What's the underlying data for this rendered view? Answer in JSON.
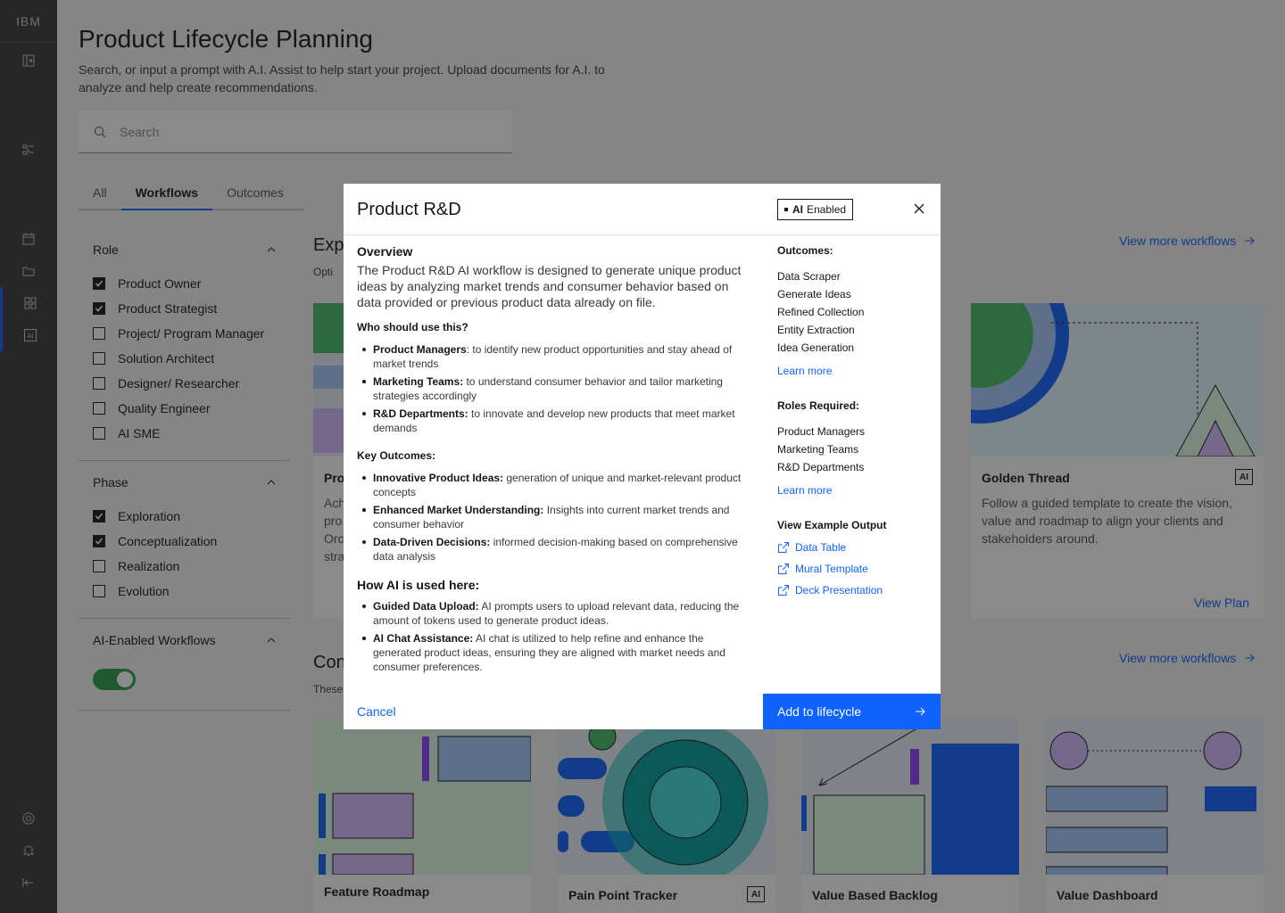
{
  "rail": {
    "logo": "IBM"
  },
  "page": {
    "title": "Product Lifecycle Planning",
    "description": "Search, or input a prompt with A.I. Assist to help start your project. Upload documents for A.I. to analyze and help create recommendations.",
    "search_placeholder": "Search",
    "tabs": [
      "All",
      "Workflows",
      "Outcomes"
    ]
  },
  "filters": {
    "role": {
      "title": "Role",
      "items": [
        {
          "label": "Product Owner",
          "checked": true
        },
        {
          "label": "Product Strategist",
          "checked": true
        },
        {
          "label": "Project/ Program Manager",
          "checked": false
        },
        {
          "label": "Solution Architect",
          "checked": false
        },
        {
          "label": "Designer/ Researcher",
          "checked": false
        },
        {
          "label": "Quality Engineer",
          "checked": false
        },
        {
          "label": "AI SME",
          "checked": false
        }
      ]
    },
    "phase": {
      "title": "Phase",
      "items": [
        {
          "label": "Exploration",
          "checked": true
        },
        {
          "label": "Conceptualization",
          "checked": true
        },
        {
          "label": "Realization",
          "checked": false
        },
        {
          "label": "Evolution",
          "checked": false
        }
      ]
    },
    "ai": {
      "title": "AI-Enabled Workflows",
      "on": true
    }
  },
  "sections": {
    "s1": {
      "title": "Exp",
      "sub": "Opti",
      "link": "View more workflows"
    },
    "s2": {
      "title": "Con",
      "sub": "These",
      "link": "View more workflows"
    }
  },
  "cards": {
    "pro": {
      "title": "Pro",
      "desc": "Ach pro Orc stra"
    },
    "golden": {
      "title": "Golden Thread",
      "ai": "AI",
      "desc": "Follow a guided template to create the vision, value and roadmap to align your clients and stakeholders around.",
      "link": "View Plan"
    },
    "feature": {
      "title": "Feature Roadmap"
    },
    "pain": {
      "title": "Pain Point Tracker",
      "ai": "AI"
    },
    "backlog": {
      "title": "Value Based Backlog"
    },
    "dashboard": {
      "title": "Value Dashboard"
    }
  },
  "modal": {
    "title": "Product R&D",
    "badge_ai": "AI",
    "badge_text": "Enabled",
    "overview_title": "Overview",
    "overview": "The Product R&D AI workflow is designed to generate unique product ideas by analyzing market trends and consumer behavior based on data provided or previous product data already on file.",
    "who_title": "Who should use this?",
    "who": [
      {
        "b": "Product Managers",
        "t": ": to identify new product opportunities and stay ahead of market trends"
      },
      {
        "b": "Marketing Teams:",
        "t": " to understand consumer behavior and tailor marketing strategies accordingly"
      },
      {
        "b": "R&D Departments:",
        "t": " to innovate and develop new products that meet market demands"
      }
    ],
    "key_title": "Key Outcomes:",
    "key": [
      {
        "b": "Innovative Product Ideas:",
        "t": " generation of unique and market-relevant product concepts"
      },
      {
        "b": "Enhanced Market Understanding:",
        "t": " Insights into current market trends and consumer behavior"
      },
      {
        "b": "Data-Driven Decisions:",
        "t": " informed decision-making based on comprehensive data analysis"
      }
    ],
    "how_title": "How AI is used here:",
    "how": [
      {
        "b": "Guided Data Upload:",
        "t": " AI prompts users to upload relevant data, reducing the amount of tokens used to generate product ideas."
      },
      {
        "b": "AI Chat Assistance:",
        "t": " AI chat is utilized to help refine and enhance the generated product ideas, ensuring they are aligned with market needs and consumer preferences."
      }
    ],
    "outcomes_title": "Outcomes:",
    "outcomes": [
      "Data Scraper",
      "Generate Ideas",
      "Refined Collection",
      "Entity Extraction",
      "Idea Generation"
    ],
    "learn_more": "Learn more",
    "roles_title": "Roles Required:",
    "roles": [
      "Product Managers",
      "Marketing Teams",
      "R&D Departments"
    ],
    "example_title": "View Example Output",
    "examples": [
      "Data Table",
      "Mural Template",
      "Deck Presentation"
    ],
    "cancel": "Cancel",
    "add": "Add to lifecycle"
  }
}
